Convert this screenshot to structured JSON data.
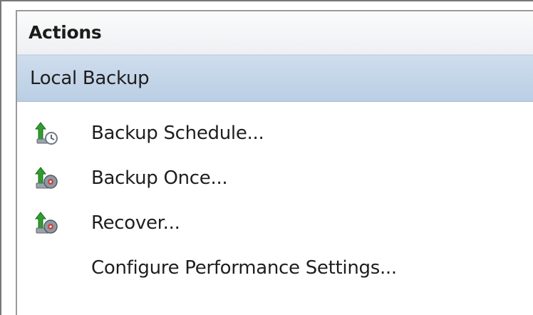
{
  "pane": {
    "title": "Actions",
    "section_title": "Local Backup",
    "items": [
      {
        "label": "Backup Schedule...",
        "icon": "backup-schedule-icon"
      },
      {
        "label": "Backup Once...",
        "icon": "backup-once-icon"
      },
      {
        "label": "Recover...",
        "icon": "recover-icon"
      },
      {
        "label": "Configure Performance Settings...",
        "icon": ""
      }
    ]
  },
  "colors": {
    "section_bg": "#c5d7eb",
    "arrow_green": "#2e9e2e",
    "disk_gray": "#6f7b86"
  }
}
